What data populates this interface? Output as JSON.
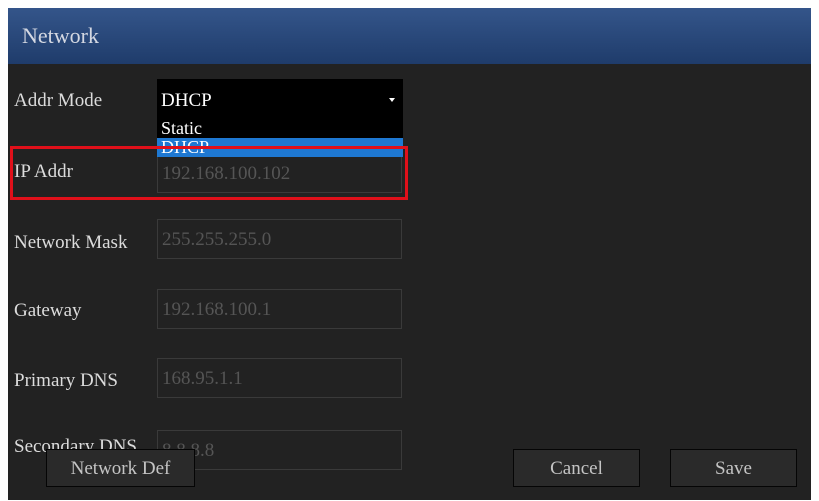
{
  "window": {
    "title": "Network"
  },
  "fields": {
    "addr_mode": {
      "label": "Addr Mode",
      "value": "DHCP",
      "options": [
        "Static",
        "DHCP"
      ]
    },
    "ip_addr": {
      "label": "IP Addr",
      "value": "192.168.100.102"
    },
    "network_mask": {
      "label": "Network Mask",
      "value": "255.255.255.0"
    },
    "gateway": {
      "label": "Gateway",
      "value": "192.168.100.1"
    },
    "primary_dns": {
      "label": "Primary DNS",
      "value": "168.95.1.1"
    },
    "secondary_dns": {
      "label": "Secondary DNS",
      "value": "8.8.8.8"
    }
  },
  "buttons": {
    "network_def": "Network Def",
    "cancel": "Cancel",
    "save": "Save"
  },
  "colors": {
    "title_bar": "#2b4c80",
    "background": "#222222",
    "selected_option": "#1e78d2",
    "highlight": "#e0101a"
  }
}
